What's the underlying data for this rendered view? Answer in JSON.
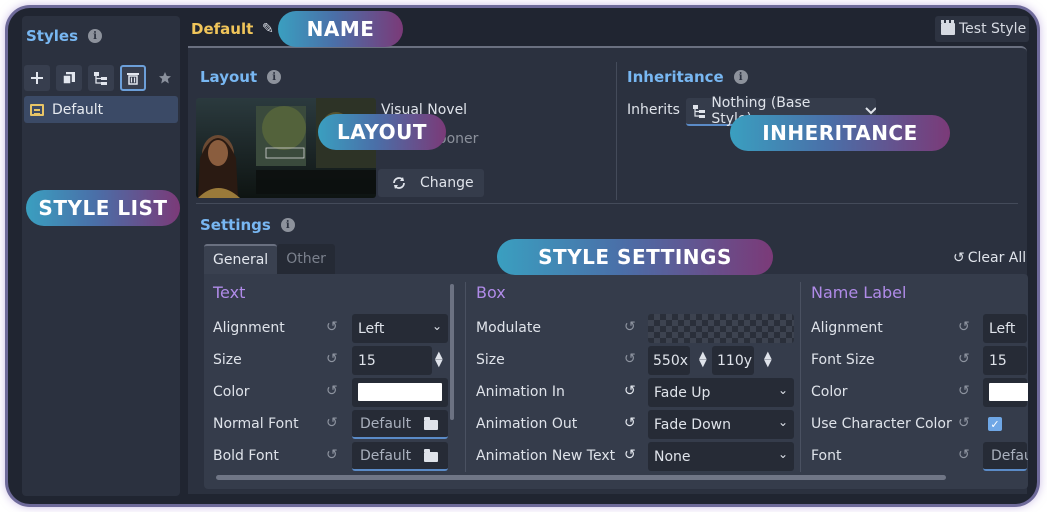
{
  "styles_panel": {
    "title": "Styles",
    "items": [
      {
        "label": "Default",
        "selected": true
      }
    ]
  },
  "header": {
    "style_name": "Default",
    "test_style_label": "Test Style"
  },
  "layout": {
    "title": "Layout",
    "name": "Visual Novel",
    "author_partial": "ooner",
    "change_label": "Change"
  },
  "inheritance": {
    "title": "Inheritance",
    "inherits_label": "Inherits",
    "selected": "Nothing (Base Style)"
  },
  "settings": {
    "title": "Settings",
    "tabs": [
      {
        "label": "General",
        "active": true
      },
      {
        "label": "Other",
        "active": false
      }
    ],
    "clear_all_label": "Clear All",
    "text_column": {
      "title": "Text",
      "alignment_label": "Alignment",
      "alignment_value": "Left",
      "size_label": "Size",
      "size_value": "15",
      "color_label": "Color",
      "color_value": "#ffffff",
      "normal_font_label": "Normal Font",
      "normal_font_value": "Default",
      "bold_font_label": "Bold Font",
      "bold_font_value": "Default"
    },
    "box_column": {
      "title": "Box",
      "modulate_label": "Modulate",
      "size_label": "Size",
      "size_x": "550x",
      "size_y": "110y",
      "anim_in_label": "Animation In",
      "anim_in_value": "Fade Up",
      "anim_out_label": "Animation Out",
      "anim_out_value": "Fade Down",
      "anim_new_label": "Animation New Text",
      "anim_new_value": "None"
    },
    "name_column": {
      "title": "Name Label",
      "alignment_label": "Alignment",
      "alignment_value": "Left",
      "font_size_label": "Font Size",
      "font_size_value": "15",
      "color_label": "Color",
      "color_value": "#ffffff",
      "use_char_color_label": "Use Character Color",
      "use_char_color_checked": true,
      "font_label": "Font",
      "font_value_partial": "Defau"
    }
  },
  "callouts": {
    "name": "NAME",
    "layout": "LAYOUT",
    "inheritance": "INHERITANCE",
    "style_list": "STYLE LIST",
    "style_settings": "STYLE SETTINGS"
  },
  "colors": {
    "accent_blue": "#78b7f2",
    "name_yellow": "#f0c55a",
    "column_title_purple": "#b08be8"
  }
}
